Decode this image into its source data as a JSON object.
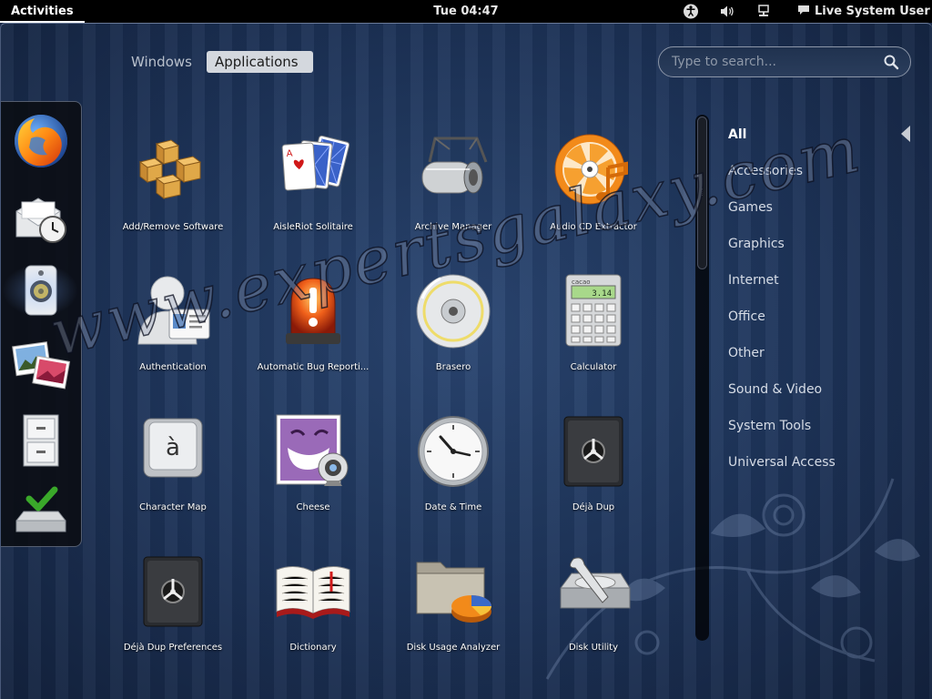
{
  "topbar": {
    "activities": "Activities",
    "clock": "Tue 04:47",
    "user": "Live System User",
    "tray_icons": [
      "accessibility-icon",
      "volume-icon",
      "network-icon",
      "chat-icon"
    ]
  },
  "view_selector": {
    "tabs": [
      {
        "label": "Windows",
        "active": false
      },
      {
        "label": "Applications",
        "active": true
      }
    ]
  },
  "search": {
    "placeholder": "Type to search...",
    "value": ""
  },
  "dash": {
    "items": [
      {
        "name": "firefox",
        "icon": "firefox-icon",
        "running": false
      },
      {
        "name": "evolution",
        "icon": "mail-clock-icon",
        "running": false
      },
      {
        "name": "rhythmbox",
        "icon": "speaker-icon",
        "running": true
      },
      {
        "name": "shotwell",
        "icon": "photos-icon",
        "running": false
      },
      {
        "name": "files",
        "icon": "file-cabinet-icon",
        "running": false
      },
      {
        "name": "install",
        "icon": "install-drive-icon",
        "running": false
      }
    ]
  },
  "apps": [
    {
      "label": "Add/Remove Software",
      "icon": "boxes-icon"
    },
    {
      "label": "AisleRiot Solitaire",
      "icon": "cards-icon"
    },
    {
      "label": "Archive Manager",
      "icon": "archive-roller-icon"
    },
    {
      "label": "Audio CD Extractor",
      "icon": "cd-orange-icon"
    },
    {
      "label": "Authentication",
      "icon": "user-id-icon"
    },
    {
      "label": "Automatic Bug Reporti...",
      "icon": "alarm-light-icon"
    },
    {
      "label": "Brasero",
      "icon": "disc-burner-icon"
    },
    {
      "label": "Calculator",
      "icon": "calculator-icon"
    },
    {
      "label": "Character Map",
      "icon": "key-icon"
    },
    {
      "label": "Cheese",
      "icon": "webcam-icon"
    },
    {
      "label": "Date & Time",
      "icon": "clock-icon"
    },
    {
      "label": "Déjà Dup",
      "icon": "safe-icon"
    },
    {
      "label": "Déjà Dup Preferences",
      "icon": "safe-icon"
    },
    {
      "label": "Dictionary",
      "icon": "book-icon"
    },
    {
      "label": "Disk Usage Analyzer",
      "icon": "folder-pie-icon"
    },
    {
      "label": "Disk Utility",
      "icon": "disk-wrench-icon"
    }
  ],
  "calculator_display": "3.14",
  "calculator_brand": "cacao",
  "character_map_glyph": "à",
  "categories": [
    {
      "label": "All",
      "selected": true
    },
    {
      "label": "Accessories",
      "selected": false
    },
    {
      "label": "Games",
      "selected": false
    },
    {
      "label": "Graphics",
      "selected": false
    },
    {
      "label": "Internet",
      "selected": false
    },
    {
      "label": "Office",
      "selected": false
    },
    {
      "label": "Other",
      "selected": false
    },
    {
      "label": "Sound & Video",
      "selected": false
    },
    {
      "label": "System Tools",
      "selected": false
    },
    {
      "label": "Universal Access",
      "selected": false
    }
  ],
  "watermark": "www.expertsgalaxy.com",
  "colors": {
    "topbar": "#000000",
    "overview": "#1d3358",
    "tab_active": "#d4d8de"
  }
}
